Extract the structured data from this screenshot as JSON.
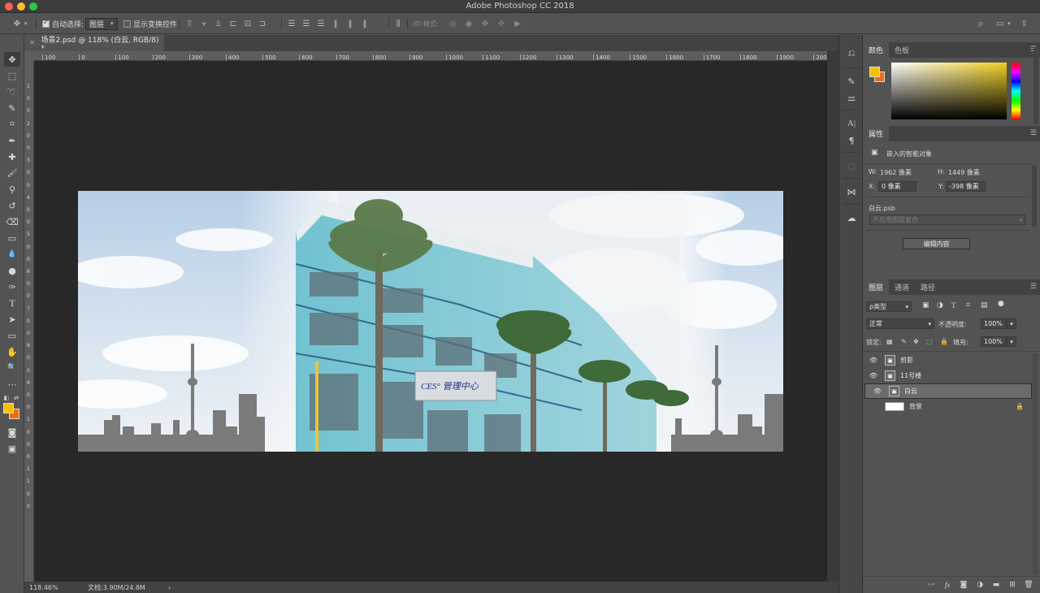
{
  "app": {
    "title": "Adobe Photoshop CC 2018"
  },
  "options_bar": {
    "auto_select_label": "自动选择:",
    "auto_select_target": "图层",
    "show_transform_label": "显示变换控件",
    "mode_3d_label": "3D 模式:"
  },
  "document": {
    "tab_title": "场景2.psd @ 118% (白云, RGB/8) *",
    "close_symbol": "×",
    "ruler_ticks": [
      "100",
      "0",
      "100",
      "200",
      "300",
      "400",
      "500",
      "600",
      "700",
      "800",
      "900",
      "1000",
      "1100",
      "1200",
      "1300",
      "1400",
      "1500",
      "1600",
      "1700",
      "1800",
      "1900",
      "2000"
    ],
    "vruler_ticks": [
      "1",
      "0",
      "0",
      "2",
      "0",
      "0",
      "3",
      "0",
      "0",
      "4",
      "0",
      "0",
      "5",
      "0",
      "0",
      "6",
      "0",
      "0",
      "7",
      "0",
      "0",
      "8",
      "0",
      "0",
      "9",
      "0",
      "0",
      "1",
      "0",
      "0",
      "0",
      "1",
      "1",
      "0",
      "0"
    ],
    "zoom": "118.46%",
    "doc_size": "文档:3.90M/24.8M",
    "status_arrow": "›",
    "sign_text": "CES° 管理中心"
  },
  "colors": {
    "foreground": "#f5c000",
    "background": "#ec6d16",
    "picker_hue": "#f0d020"
  },
  "color_panel": {
    "tabs": [
      "颜色",
      "色板"
    ]
  },
  "properties_panel": {
    "tab": "属性",
    "object_type": "嵌入的智能对象",
    "w_label": "W:",
    "w_value": "1962 像素",
    "h_label": "H:",
    "h_value": "1449 像素",
    "x_label": "X:",
    "x_value": "0 像素",
    "y_label": "Y:",
    "y_value": "-398 像素",
    "file_name": "白云.psb",
    "comp_placeholder": "不应用图层复合",
    "edit_button": "编辑内容"
  },
  "layers_panel": {
    "tabs": [
      "图层",
      "通道",
      "路径"
    ],
    "filter_kind": "ρ类型",
    "blend_mode": "正常",
    "opacity_label": "不透明度:",
    "opacity_value": "100%",
    "lock_label": "锁定:",
    "fill_label": "填充:",
    "fill_value": "100%",
    "layers": [
      {
        "name": "剪影",
        "visible": true,
        "selected": false
      },
      {
        "name": "11号楼",
        "visible": true,
        "selected": false
      },
      {
        "name": "白云",
        "visible": true,
        "selected": true
      },
      {
        "name": "背景",
        "visible": false,
        "selected": false,
        "locked": true
      }
    ]
  },
  "icons": {
    "move": "✥",
    "marquee": "⬚",
    "lasso": "➰",
    "quick_select": "✎",
    "crop": "⌗",
    "eyedropper": "✒",
    "heal": "✚",
    "brush": "🖌",
    "stamp": "⚲",
    "history_brush": "↺",
    "eraser": "⌫",
    "gradient": "▭",
    "blur": "💧",
    "dodge": "●",
    "pen": "✑",
    "type": "T",
    "path_select": "➤",
    "shape": "▭",
    "hand": "✋",
    "zoom": "🔍",
    "more": "⋯",
    "quick_mask": "◙",
    "screen_mode": "▣",
    "search": "⌕",
    "workspace": "▭",
    "share": "⇪"
  }
}
